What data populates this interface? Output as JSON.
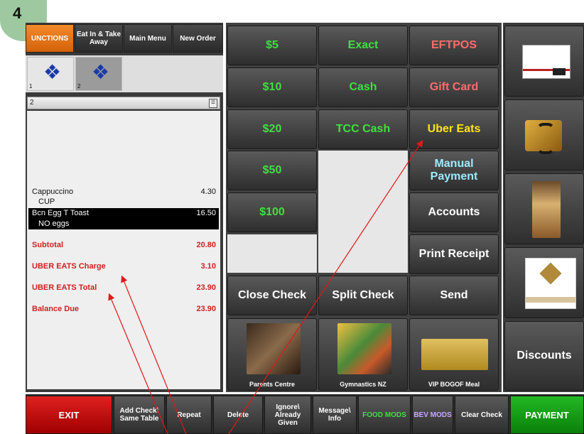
{
  "step": "4",
  "top_buttons": [
    {
      "label": "UNCTIONS"
    },
    {
      "label": "Eat In & Take Away"
    },
    {
      "label": "Main Menu"
    },
    {
      "label": "New Order"
    }
  ],
  "seats": [
    {
      "num": "1"
    },
    {
      "num": "2"
    }
  ],
  "order": {
    "header": "2",
    "lines": [
      {
        "name": "Cappuccino",
        "value": "4.30"
      },
      {
        "name": "CUP",
        "value": ""
      },
      {
        "name": "Bcn Egg T Toast",
        "value": "16.50"
      },
      {
        "name": "NO eggs",
        "value": ""
      }
    ],
    "totals": [
      {
        "name": "Subtotal",
        "value": "20.80"
      },
      {
        "name": "UBER EATS Charge",
        "value": "3.10"
      },
      {
        "name": "UBER EATS Total",
        "value": "23.90"
      },
      {
        "name": "Balance Due",
        "value": "23.90"
      }
    ]
  },
  "payment": {
    "amounts": [
      "$5",
      "$10",
      "$20",
      "$50",
      "$100"
    ],
    "exact": "Exact",
    "cash": "Cash",
    "tcc_cash": "TCC Cash",
    "eftpos": "EFTPOS",
    "gift_card": "Gift Card",
    "uber_eats": "Uber Eats",
    "manual_payment": "Manual Payment",
    "accounts": "Accounts",
    "print_receipt": "Print Receipt",
    "close_check": "Close Check",
    "split_check": "Split Check",
    "send": "Send"
  },
  "promos": [
    {
      "caption": "Parents Centre"
    },
    {
      "caption": "Gymnastics NZ"
    },
    {
      "caption": "VIP BOGOF Meal"
    }
  ],
  "discounts": "Discounts",
  "bottom": {
    "exit": "EXIT",
    "add_check": "Add Check\\ Same Table",
    "repeat": "Repeat",
    "delete": "Delete",
    "ignore": "Ignore\\ Already Given",
    "message": "Message\\ Info",
    "food_mods": "FOOD MODS",
    "bev_mods": "BEV MODS",
    "clear_check": "Clear Check",
    "payment": "PAYMENT"
  },
  "colors": {
    "green_text": "#3fe03f",
    "red_text": "#ff6b6b",
    "yellow_text": "#ffe21a",
    "cyan_text": "#9ee9ff",
    "total_red": "#d02020",
    "exit_red": "#e02020",
    "payment_green": "#22b822"
  }
}
